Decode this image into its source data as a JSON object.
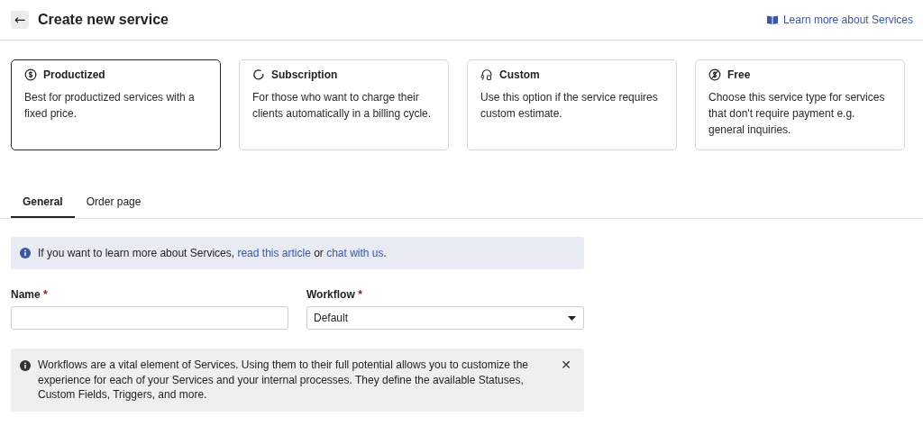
{
  "header": {
    "back": "←",
    "title": "Create new service",
    "help_link": "Learn more about Services"
  },
  "service_types": [
    {
      "kind": "productized",
      "title": "Productized",
      "description": "Best for productized services with a fixed price.",
      "selected": true
    },
    {
      "kind": "subscription",
      "title": "Subscription",
      "description": "For those who want to charge their clients automatically in a billing cycle.",
      "selected": false
    },
    {
      "kind": "custom",
      "title": "Custom",
      "description": "Use this option if the service requires custom estimate.",
      "selected": false
    },
    {
      "kind": "free",
      "title": "Free",
      "description": "Choose this service type for services that don't require payment e.g. general inquiries.",
      "selected": false
    }
  ],
  "tabs": [
    {
      "label": "General",
      "selected": true
    },
    {
      "label": "Order page",
      "selected": false
    }
  ],
  "info_banner": {
    "parts": [
      {
        "kind": "text",
        "text": "If you want to learn more about Services, "
      },
      {
        "kind": "link",
        "text": "read this article"
      },
      {
        "kind": "text",
        "text": " or "
      },
      {
        "kind": "link",
        "text": "chat with us"
      },
      {
        "kind": "text",
        "text": "."
      }
    ]
  },
  "fields": [
    {
      "kind": "text",
      "label": "Name",
      "required_mark": "*"
    },
    {
      "kind": "select",
      "label": "Workflow",
      "required_mark": "*",
      "value": "Default"
    }
  ],
  "workflow_note": {
    "text": "Workflows are a vital element of Services. Using them to their full potential allows you to customize the experience for each of your Services and your internal processes. They define the available Statuses, Custom Fields, Triggers, and more.",
    "close": "✕"
  }
}
